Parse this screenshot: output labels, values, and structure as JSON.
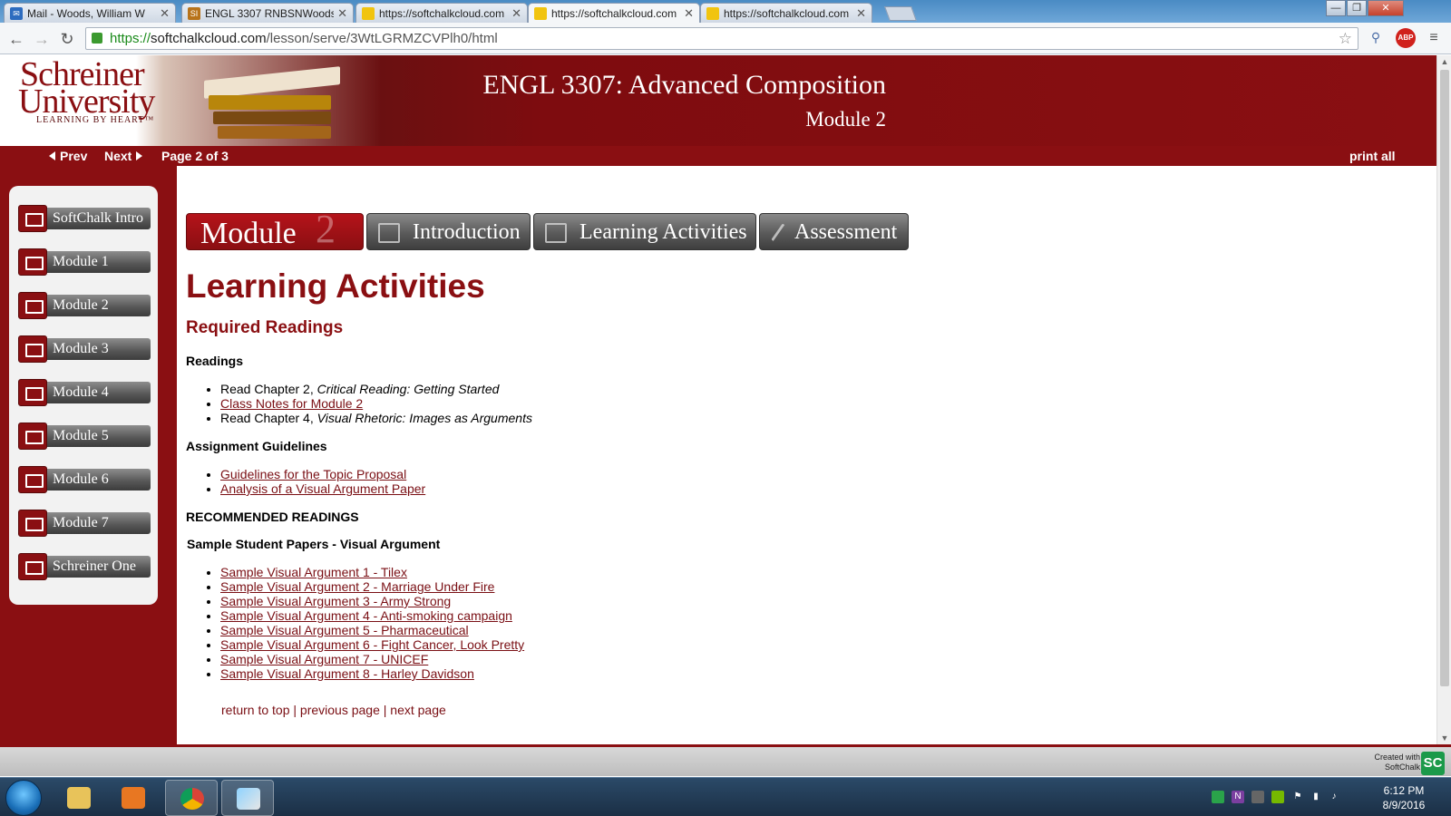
{
  "browser": {
    "tabs": [
      {
        "title": "Mail - Woods, William W",
        "favicon": "mail-icon"
      },
      {
        "title": "ENGL 3307 RNBSNWoods",
        "favicon": "sc-icon"
      },
      {
        "title": "https://softchalkcloud.com",
        "favicon": "page-icon"
      },
      {
        "title": "https://softchalkcloud.com",
        "favicon": "page-icon",
        "active": true
      },
      {
        "title": "https://softchalkcloud.com",
        "favicon": "page-icon"
      }
    ],
    "url_scheme": "https://",
    "url_host": "softchalkcloud.com",
    "url_path": "/lesson/serve/3WtLGRMZCVPlh0/html",
    "abp_label": "ABP"
  },
  "banner": {
    "logo_line1": "Schreiner",
    "logo_line2": "University",
    "logo_tagline": "LEARNING BY HEART™",
    "course_title": "ENGL 3307: Advanced Composition",
    "module_subtitle": "Module 2"
  },
  "nav": {
    "prev": "Prev",
    "next": "Next",
    "page_info": "Page 2 of 3",
    "print_all": "print all"
  },
  "sidebar": {
    "items": [
      {
        "label": "SoftChalk Intro"
      },
      {
        "label": "Module 1"
      },
      {
        "label": "Module 2"
      },
      {
        "label": "Module 3"
      },
      {
        "label": "Module 4"
      },
      {
        "label": "Module 5"
      },
      {
        "label": "Module 6"
      },
      {
        "label": "Module 7"
      },
      {
        "label": "Schreiner One"
      }
    ]
  },
  "content_tabs": {
    "module_label": "Module",
    "module_number": "2",
    "introduction": "Introduction",
    "learning_activities": "Learning Activities",
    "assessment": "Assessment"
  },
  "main": {
    "page_heading": "Learning Activities",
    "required_heading": "Required Readings",
    "readings_heading": "Readings",
    "readings": [
      {
        "prefix": "Read Chapter 2, ",
        "italic": "Critical Reading: Getting Started"
      },
      {
        "link": "Class Notes for Module 2"
      },
      {
        "prefix": "Read Chapter 4, ",
        "italic": "Visual Rhetoric: Images as Arguments"
      }
    ],
    "guidelines_heading": "Assignment Guidelines",
    "guidelines": [
      "Guidelines for the Topic Proposal",
      "Analysis of a Visual Argument Paper"
    ],
    "recommended_heading": "RECOMMENDED READINGS",
    "samples_heading": "Sample Student Papers - Visual Argument",
    "samples": [
      "Sample Visual Argument 1 - Tilex",
      "Sample Visual Argument 2 - Marriage Under Fire",
      "Sample Visual Argument 3 - Army Strong",
      "Sample Visual Argument 4 - Anti-smoking campaign",
      "Sample Visual Argument 5 - Pharmaceutical",
      "Sample Visual Argument 6 - Fight Cancer, Look Pretty",
      "Sample Visual Argument 7 - UNICEF",
      "Sample Visual Argument 8 - Harley Davidson"
    ],
    "footer_links": {
      "top": "return to top",
      "sep": " | ",
      "prev": "previous page",
      "next": "next page"
    }
  },
  "softchalk_bar": {
    "made_line1": "Created with",
    "made_line2": "SoftChalk",
    "logo": "SC"
  },
  "taskbar": {
    "time": "6:12 PM",
    "date": "8/9/2016"
  },
  "colors": {
    "brand_red": "#8a0f12",
    "link": "#7a0f14"
  }
}
